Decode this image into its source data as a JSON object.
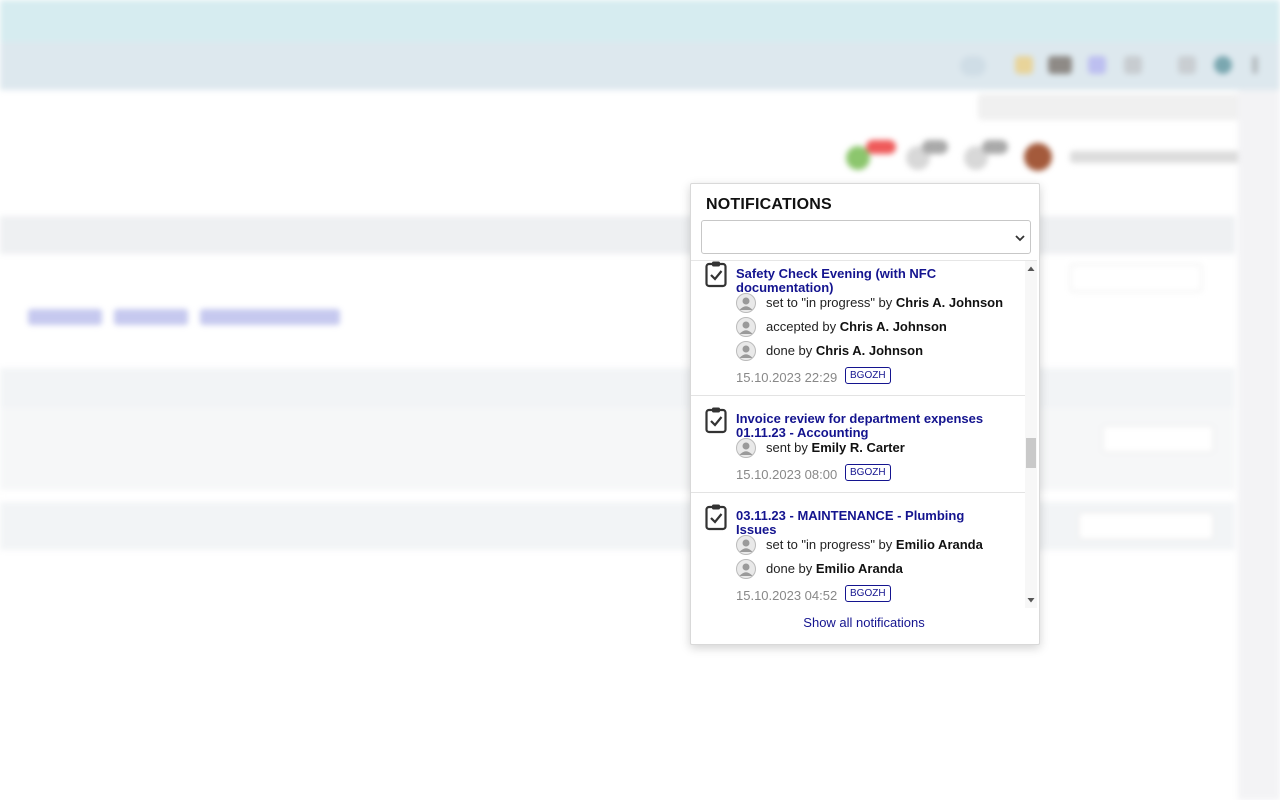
{
  "panel": {
    "title": "NOTIFICATIONS",
    "filter_value": "",
    "show_all_label": "Show all notifications"
  },
  "notifications": [
    {
      "title": "Safety Check Evening (with NFC documentation)",
      "events": [
        {
          "action": "set to \"in progress\" by",
          "user": "Chris A. Johnson"
        },
        {
          "action": "accepted by",
          "user": "Chris A. Johnson"
        },
        {
          "action": "done by",
          "user": "Chris A. Johnson"
        }
      ],
      "date": "15.10.2023 22:29",
      "badge": "BGOZH"
    },
    {
      "title": "Invoice review for department expenses 01.11.23 - Accounting",
      "events": [
        {
          "action": "sent by",
          "user": "Emily R. Carter"
        }
      ],
      "date": "15.10.2023 08:00",
      "badge": "BGOZH"
    },
    {
      "title": "03.11.23 - MAINTENANCE - Plumbing Issues",
      "events": [
        {
          "action": "set to \"in progress\" by",
          "user": "Emilio Aranda"
        },
        {
          "action": "done by",
          "user": "Emilio Aranda"
        }
      ],
      "date": "15.10.2023 04:52",
      "badge": "BGOZH"
    }
  ],
  "scroll_position": 0.5,
  "colors": {
    "link": "#14148f",
    "date": "#888888",
    "browser_tab_bar": "#d6ecf0",
    "browser_toolbar": "#dde8ee"
  }
}
